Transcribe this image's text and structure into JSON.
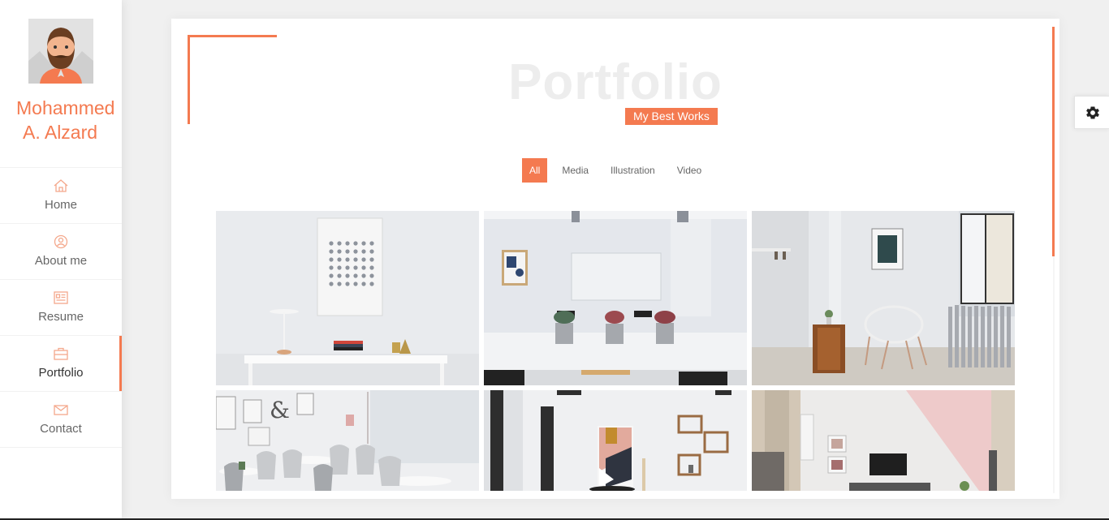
{
  "profile": {
    "name_line1": "Mohammed",
    "name_line2": "A. Alzard",
    "avatar_icon": "bearded-man-avatar"
  },
  "nav": {
    "items": [
      {
        "label": "Home",
        "icon": "home-icon"
      },
      {
        "label": "About me",
        "icon": "user-circle-icon"
      },
      {
        "label": "Resume",
        "icon": "resume-icon"
      },
      {
        "label": "Portfolio",
        "icon": "briefcase-icon",
        "active": true
      },
      {
        "label": "Contact",
        "icon": "envelope-icon"
      }
    ]
  },
  "portfolio": {
    "title": "Portfolio",
    "subtitle": "My Best Works",
    "filters": [
      {
        "label": "All",
        "active": true
      },
      {
        "label": "Media"
      },
      {
        "label": "Illustration"
      },
      {
        "label": "Video"
      }
    ],
    "items": [
      {
        "name": "white-desk-photo"
      },
      {
        "name": "meeting-room-photo"
      },
      {
        "name": "white-chair-room-photo"
      },
      {
        "name": "cafe-tables-photo"
      },
      {
        "name": "shelf-room-photo"
      },
      {
        "name": "tv-room-photo"
      }
    ]
  },
  "settings": {
    "icon": "gear-icon"
  },
  "colors": {
    "accent": "#f47a50",
    "title_watermark": "#ededed",
    "background": "#f0f0f0"
  }
}
